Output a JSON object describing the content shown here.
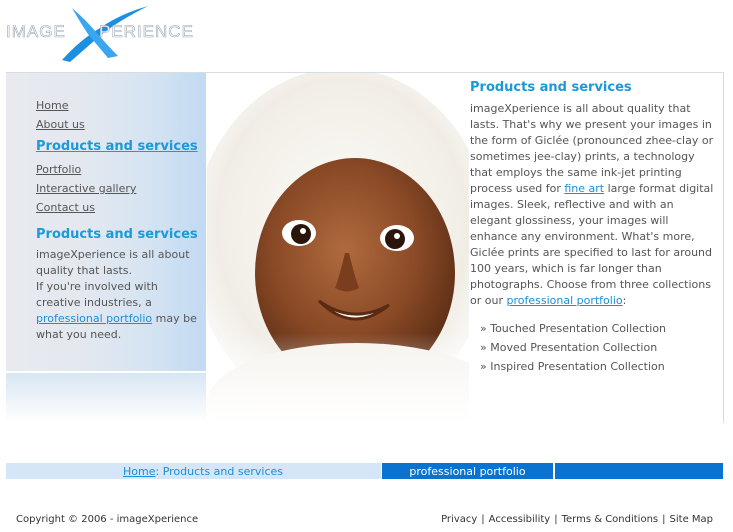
{
  "logo": {
    "pre": "IMAGE",
    "x": "X",
    "post": "PERIENCE"
  },
  "nav": [
    {
      "label": "Home",
      "current": false
    },
    {
      "label": "About us",
      "current": false
    },
    {
      "label": "Products and services",
      "current": true
    },
    {
      "label": "Portfolio",
      "current": false
    },
    {
      "label": "Interactive gallery",
      "current": false
    },
    {
      "label": "Contact us",
      "current": false
    }
  ],
  "sidebar": {
    "heading": "Products and services",
    "text1": "imageXperience is all about quality that lasts.",
    "text2": "If you're involved with creative industries, a ",
    "link": "professional portfolio",
    "text3": " may be what you need."
  },
  "content": {
    "heading": "Products and services",
    "p1": "imageXperience is all about quality that lasts. That's why we present your images in the form of Giclée (pronounced zhee-clay or sometimes jee-clay) prints, a technology that employs the same ink-jet printing process used for ",
    "link1": "fine art",
    "p2": " large format digital images. Sleek, reflective and with an elegant glossiness, your images will enhance any environment. What's more, Giclée prints are specified to last for around 100 years, which is far longer than photographs.  Choose from three collections or our ",
    "link2": "professional portfolio",
    "p3": ":",
    "collections": [
      "» Touched Presentation Collection",
      "» Moved Presentation Collection",
      "» Inspired Presentation Collection"
    ]
  },
  "breadcrumb": {
    "home": "Home",
    "sep": ": ",
    "current": "Products and services"
  },
  "portfolio_bar": "professional portfolio",
  "footer": {
    "copyright": "Copyright © 2006 - imageXperience",
    "links": [
      "Privacy",
      "Accessibility",
      "Terms & Conditions",
      "Site Map"
    ],
    "sep": "|"
  },
  "colors": {
    "accent": "#1a9ad9",
    "bar_blue": "#0a73d0",
    "bar_light": "#d4e6f7"
  }
}
